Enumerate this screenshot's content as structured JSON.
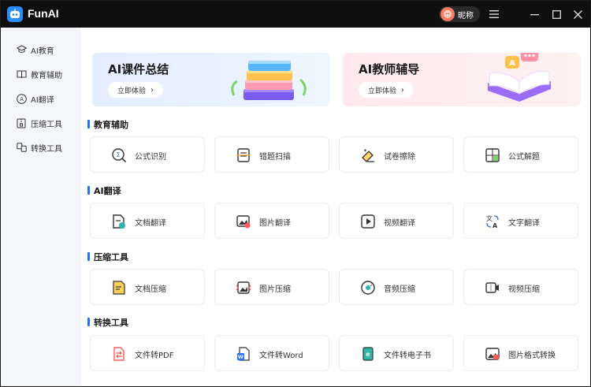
{
  "app": {
    "name": "FunAI"
  },
  "user": {
    "name": "昵称"
  },
  "sidebar": {
    "items": [
      {
        "label": "AI教育",
        "icon": "graduation-cap-icon"
      },
      {
        "label": "教育辅助",
        "icon": "open-book-icon"
      },
      {
        "label": "AI翻译",
        "icon": "translate-icon"
      },
      {
        "label": "压缩工具",
        "icon": "compress-icon"
      },
      {
        "label": "转换工具",
        "icon": "convert-icon"
      }
    ]
  },
  "banners": [
    {
      "title": "AI课件总结",
      "button": "立即体验"
    },
    {
      "title": "AI教师辅导",
      "button": "立即体验"
    }
  ],
  "sections": [
    {
      "title": "教育辅助",
      "cards": [
        {
          "label": "公式识别",
          "icon": "formula-scan-icon"
        },
        {
          "label": "错题扫描",
          "icon": "error-scan-icon"
        },
        {
          "label": "试卷擦除",
          "icon": "eraser-icon"
        },
        {
          "label": "公式解题",
          "icon": "calculator-icon"
        }
      ]
    },
    {
      "title": "AI翻译",
      "cards": [
        {
          "label": "文档翻译",
          "icon": "doc-translate-icon"
        },
        {
          "label": "图片翻译",
          "icon": "image-translate-icon"
        },
        {
          "label": "视频翻译",
          "icon": "video-translate-icon"
        },
        {
          "label": "文字翻译",
          "icon": "text-translate-icon"
        }
      ]
    },
    {
      "title": "压缩工具",
      "cards": [
        {
          "label": "文档压缩",
          "icon": "doc-compress-icon"
        },
        {
          "label": "图片压缩",
          "icon": "image-compress-icon"
        },
        {
          "label": "音频压缩",
          "icon": "audio-compress-icon"
        },
        {
          "label": "视频压缩",
          "icon": "video-compress-icon"
        }
      ]
    },
    {
      "title": "转换工具",
      "cards": [
        {
          "label": "文件转PDF",
          "icon": "pdf-convert-icon"
        },
        {
          "label": "文件转Word",
          "icon": "word-convert-icon"
        },
        {
          "label": "文件转电子书",
          "icon": "ebook-convert-icon"
        },
        {
          "label": "图片格式转换",
          "icon": "image-format-icon"
        }
      ]
    }
  ],
  "colors": {
    "titlebar": "#0f0f10",
    "accent": "#2b6ff5",
    "sidebar_bg": "#f4f6fa"
  }
}
